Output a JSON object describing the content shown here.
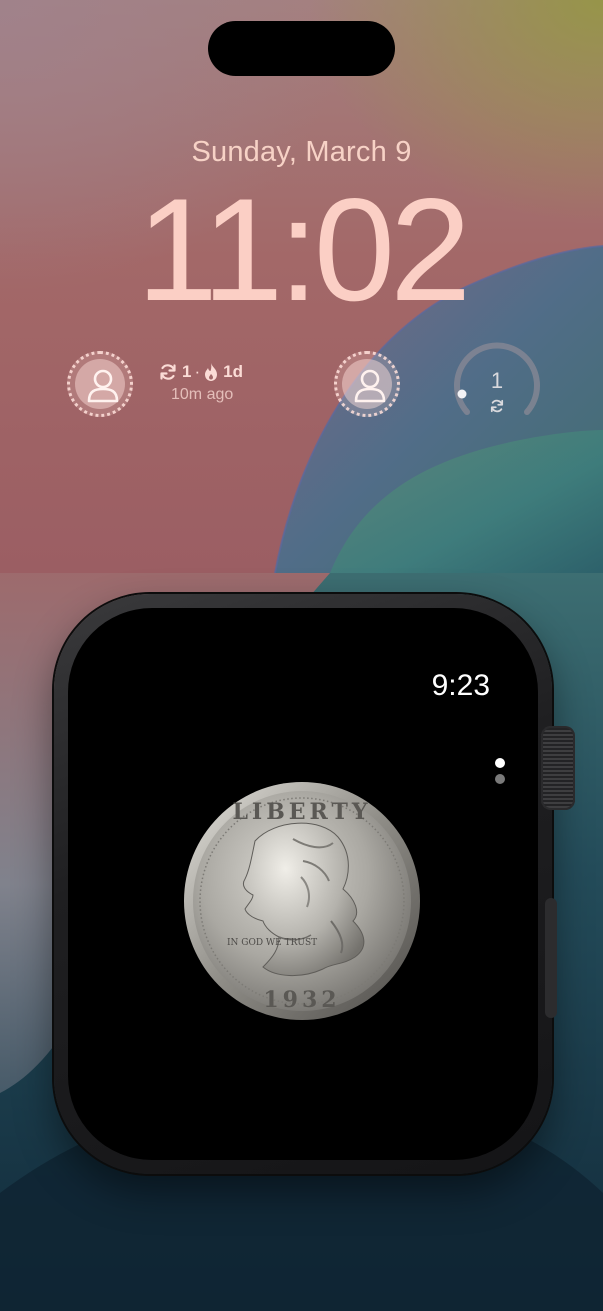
{
  "lock_screen": {
    "date": "Sunday, March 9",
    "time": "11:02",
    "widgets": {
      "stats": {
        "streak_count": "1",
        "separator": "·",
        "fire_days": "1d",
        "subtitle": "10m ago"
      },
      "gauge": {
        "value": "1"
      }
    }
  },
  "watch": {
    "time": "9:23",
    "page_indicator": {
      "pages": 2,
      "current": 1
    },
    "coin_image": {
      "legend_top": "LIBERTY",
      "motto": "IN GOD WE TRUST",
      "year": "1932"
    }
  },
  "colors": {
    "lock_text": "#fbcfc5",
    "watch_screen": "#000000",
    "watch_time": "#ffffff"
  }
}
